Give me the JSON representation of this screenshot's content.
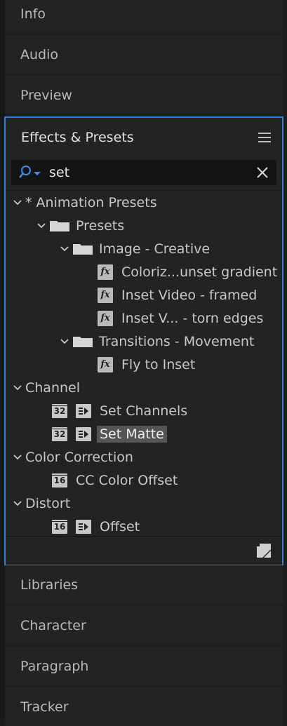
{
  "panels_top": [
    {
      "label": "Info"
    },
    {
      "label": "Audio"
    },
    {
      "label": "Preview"
    }
  ],
  "effects_panel": {
    "title": "Effects & Presets",
    "menu_icon": "hamburger-menu-icon",
    "accent_color": "#2d7fd9"
  },
  "search": {
    "value": "set",
    "icon": "search-icon",
    "clear_icon": "close-icon"
  },
  "tree": {
    "animation_presets": "* Animation Presets",
    "presets": "Presets",
    "image_creative": "Image - Creative",
    "colorize": "Coloriz...unset gradient",
    "inset_video_framed": "Inset Video - framed",
    "inset_v_torn": "Inset V... - torn edges",
    "transitions_movement": "Transitions - Movement",
    "fly_to_inset": "Fly to Inset",
    "channel": "Channel",
    "set_channels": "Set Channels",
    "set_matte": "Set Matte",
    "color_correction": "Color Correction",
    "cc_color_offset": "CC Color Offset",
    "distort": "Distort",
    "offset": "Offset",
    "badge_32": "32",
    "badge_16": "16",
    "fx": "fx"
  },
  "panels_bottom": [
    {
      "label": "Libraries"
    },
    {
      "label": "Character"
    },
    {
      "label": "Paragraph"
    },
    {
      "label": "Tracker"
    }
  ]
}
